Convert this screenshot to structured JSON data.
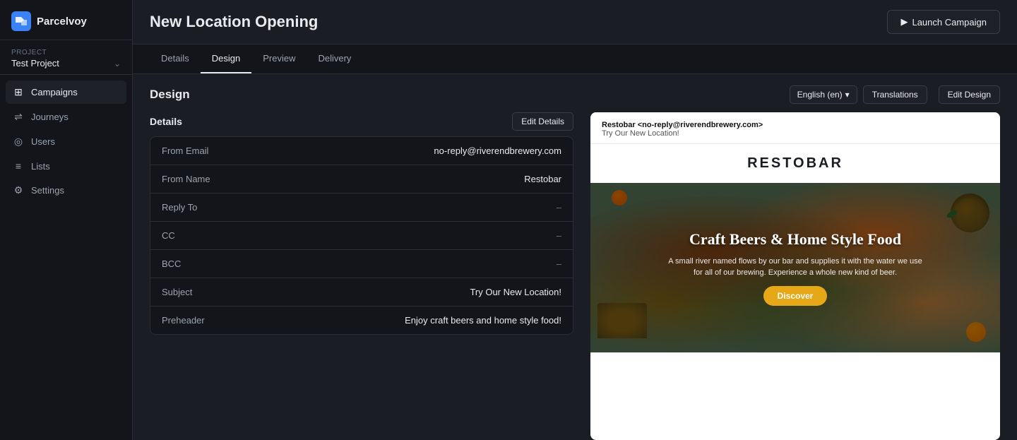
{
  "app": {
    "logo_text": "Parcelvoy",
    "logo_icon": "◈"
  },
  "project": {
    "label": "Project",
    "name": "Test Project",
    "chevron": "⌃"
  },
  "sidebar": {
    "items": [
      {
        "id": "campaigns",
        "label": "Campaigns",
        "icon": "⊞",
        "active": true
      },
      {
        "id": "journeys",
        "label": "Journeys",
        "icon": "⇌",
        "active": false
      },
      {
        "id": "users",
        "label": "Users",
        "icon": "◎",
        "active": false
      },
      {
        "id": "lists",
        "label": "Lists",
        "icon": "≡",
        "active": false
      },
      {
        "id": "settings",
        "label": "Settings",
        "icon": "⚙",
        "active": false
      }
    ]
  },
  "header": {
    "title": "New Location Opening",
    "launch_btn": "Launch Campaign",
    "launch_icon": "▶"
  },
  "tabs": [
    {
      "id": "details",
      "label": "Details",
      "active": false
    },
    {
      "id": "design",
      "label": "Design",
      "active": true
    },
    {
      "id": "preview",
      "label": "Preview",
      "active": false
    },
    {
      "id": "delivery",
      "label": "Delivery",
      "active": false
    }
  ],
  "design_section": {
    "title": "Design",
    "lang_value": "English (en)",
    "translations_label": "Translations",
    "edit_design_label": "Edit Design"
  },
  "details_section": {
    "title": "Details",
    "edit_label": "Edit Details",
    "rows": [
      {
        "label": "From Email",
        "value": "no-reply@riverendbrewery.com",
        "muted": false
      },
      {
        "label": "From Name",
        "value": "Restobar",
        "muted": false
      },
      {
        "label": "Reply To",
        "value": "–",
        "muted": true
      },
      {
        "label": "CC",
        "value": "–",
        "muted": true
      },
      {
        "label": "BCC",
        "value": "–",
        "muted": true
      },
      {
        "label": "Subject",
        "value": "Try Our New Location!",
        "muted": false
      },
      {
        "label": "Preheader",
        "value": "Enjoy craft beers and home style food!",
        "muted": false
      }
    ]
  },
  "email_preview": {
    "from_name": "Restobar",
    "from_email": "<no-reply@riverendbrewery.com>",
    "subject": "Try Our New Location!",
    "logo": "RESTOBAR",
    "hero_title": "Craft Beers & Home Style Food",
    "hero_desc_line1": "A small river named flows by our bar and supplies it with the water we use",
    "hero_desc_line2": "for all of our brewing. Experience a whole new kind of beer.",
    "discover_label": "Discover"
  }
}
